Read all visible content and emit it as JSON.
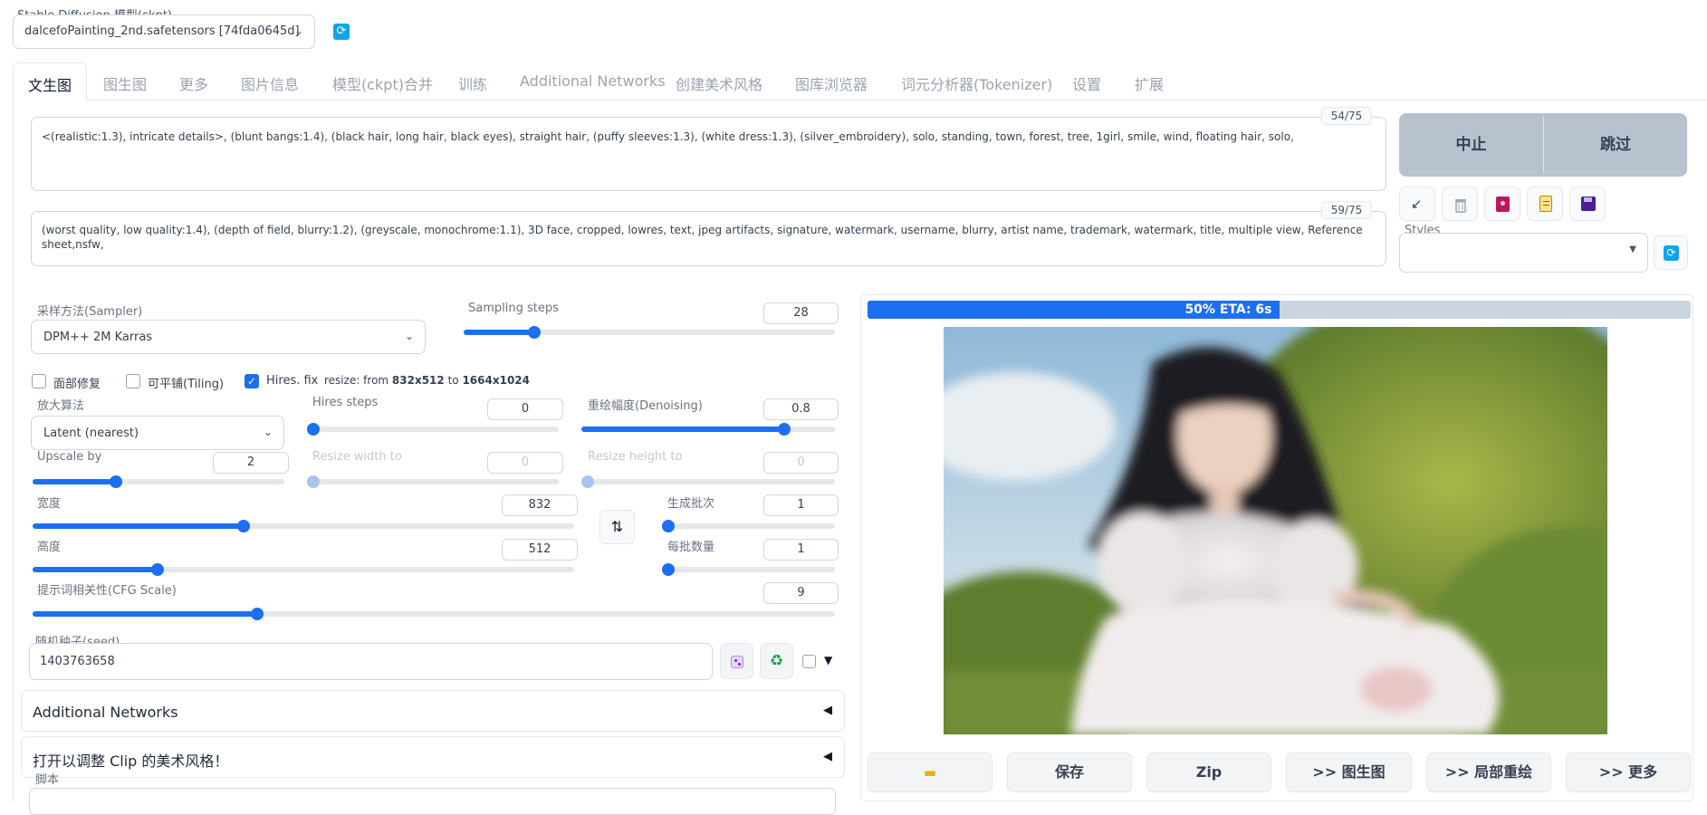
{
  "model": {
    "label": "Stable Diffusion 模型(ckpt)",
    "value": "dalcefoPainting_2nd.safetensors [74fda0645d]"
  },
  "tabs": [
    "文生图",
    "图生图",
    "更多",
    "图片信息",
    "模型(ckpt)合并",
    "训练",
    "Additional Networks",
    "创建美术风格",
    "图库浏览器",
    "词元分析器(Tokenizer)",
    "设置",
    "扩展"
  ],
  "prompt": {
    "text": "<(realistic:1.3), intricate details>, (blunt bangs:1.4), (black hair, long hair, black eyes), straight hair, (puffy sleeves:1.3), (white dress:1.3), (silver_embroidery), solo, standing, town, forest, tree, 1girl, smile, wind, floating hair, solo,",
    "counter": "54/75"
  },
  "negative": {
    "text": "(worst quality, low quality:1.4), (depth of field, blurry:1.2), (greyscale, monochrome:1.1), 3D face, cropped, lowres, text, jpeg artifacts, signature, watermark, username, blurry, artist name, trademark, watermark, title, multiple view, Reference sheet,nsfw,",
    "counter": "59/75"
  },
  "actions": {
    "interrupt": "中止",
    "skip": "跳过"
  },
  "styles": {
    "label": "Styles",
    "value": ""
  },
  "sampler": {
    "label": "采样方法(Sampler)",
    "value": "DPM++ 2M Karras"
  },
  "steps": {
    "label": "Sampling steps",
    "value": "28",
    "fraction": 0.19
  },
  "checkboxes": {
    "face": "面部修复",
    "tiling": "可平铺(Tiling)",
    "hires": "Hires. fix"
  },
  "resize_info": {
    "prefix": "resize: from ",
    "from": "832x512",
    "to_word": " to ",
    "to": "1664x1024"
  },
  "upscaler": {
    "label": "放大算法",
    "value": "Latent (nearest)"
  },
  "hires_steps": {
    "label": "Hires steps",
    "value": "0",
    "fraction": 0
  },
  "denoise": {
    "label": "重绘幅度(Denoising)",
    "value": "0.8",
    "fraction": 0.8
  },
  "upscale_by": {
    "label": "Upscale by",
    "value": "2",
    "fraction": 0.33
  },
  "resize_w": {
    "label": "Resize width to",
    "value": "0",
    "fraction": 0
  },
  "resize_h": {
    "label": "Resize height to",
    "value": "0",
    "fraction": 0
  },
  "width": {
    "label": "宽度",
    "value": "832",
    "fraction": 0.39
  },
  "height": {
    "label": "高度",
    "value": "512",
    "fraction": 0.23
  },
  "batch_count": {
    "label": "生成批次",
    "value": "1",
    "fraction": 0
  },
  "batch_size": {
    "label": "每批数量",
    "value": "1",
    "fraction": 0
  },
  "cfg": {
    "label": "提示词相关性(CFG Scale)",
    "value": "9",
    "fraction": 0.28
  },
  "seed": {
    "label": "随机种子(seed)",
    "value": "1403763658"
  },
  "accordions": {
    "networks": "Additional Networks",
    "clip": "打开以调整 Clip 的美术风格！",
    "script": "脚本"
  },
  "progress": {
    "text": "50% ETA: 6s",
    "fraction": 0.5
  },
  "output_buttons": {
    "save": "保存",
    "zip": "Zip",
    "img2img": ">> 图生图",
    "inpaint": ">> 局部重绘",
    "extras": ">> 更多"
  },
  "colors": {
    "accent": "#1d6ff2",
    "progress_bg": "#cbd5e1",
    "action_bg": "#b8c2cf"
  }
}
